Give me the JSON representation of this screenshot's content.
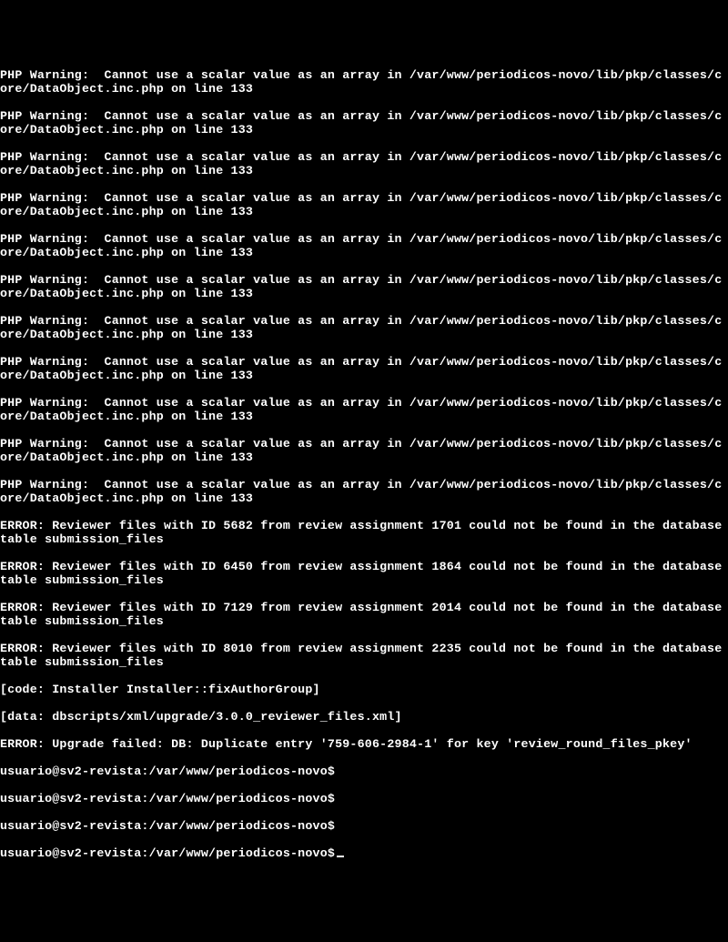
{
  "warnings": [
    "PHP Warning:  Cannot use a scalar value as an array in /var/www/periodicos-novo/lib/pkp/classes/core/DataObject.inc.php on line 133",
    "PHP Warning:  Cannot use a scalar value as an array in /var/www/periodicos-novo/lib/pkp/classes/core/DataObject.inc.php on line 133",
    "PHP Warning:  Cannot use a scalar value as an array in /var/www/periodicos-novo/lib/pkp/classes/core/DataObject.inc.php on line 133",
    "PHP Warning:  Cannot use a scalar value as an array in /var/www/periodicos-novo/lib/pkp/classes/core/DataObject.inc.php on line 133",
    "PHP Warning:  Cannot use a scalar value as an array in /var/www/periodicos-novo/lib/pkp/classes/core/DataObject.inc.php on line 133",
    "PHP Warning:  Cannot use a scalar value as an array in /var/www/periodicos-novo/lib/pkp/classes/core/DataObject.inc.php on line 133",
    "PHP Warning:  Cannot use a scalar value as an array in /var/www/periodicos-novo/lib/pkp/classes/core/DataObject.inc.php on line 133",
    "PHP Warning:  Cannot use a scalar value as an array in /var/www/periodicos-novo/lib/pkp/classes/core/DataObject.inc.php on line 133",
    "PHP Warning:  Cannot use a scalar value as an array in /var/www/periodicos-novo/lib/pkp/classes/core/DataObject.inc.php on line 133",
    "PHP Warning:  Cannot use a scalar value as an array in /var/www/periodicos-novo/lib/pkp/classes/core/DataObject.inc.php on line 133",
    "PHP Warning:  Cannot use a scalar value as an array in /var/www/periodicos-novo/lib/pkp/classes/core/DataObject.inc.php on line 133"
  ],
  "errors": [
    "ERROR: Reviewer files with ID 5682 from review assignment 1701 could not be found in the database table submission_files",
    "ERROR: Reviewer files with ID 6450 from review assignment 1864 could not be found in the database table submission_files",
    "ERROR: Reviewer files with ID 7129 from review assignment 2014 could not be found in the database table submission_files",
    "ERROR: Reviewer files with ID 8010 from review assignment 2235 could not be found in the database table submission_files"
  ],
  "diag": [
    "[code: Installer Installer::fixAuthorGroup]",
    "[data: dbscripts/xml/upgrade/3.0.0_reviewer_files.xml]",
    "ERROR: Upgrade failed: DB: Duplicate entry '759-606-2984-1' for key 'review_round_files_pkey'"
  ],
  "prompts": [
    "usuario@sv2-revista:/var/www/periodicos-novo$",
    "usuario@sv2-revista:/var/www/periodicos-novo$",
    "usuario@sv2-revista:/var/www/periodicos-novo$",
    "usuario@sv2-revista:/var/www/periodicos-novo$"
  ]
}
